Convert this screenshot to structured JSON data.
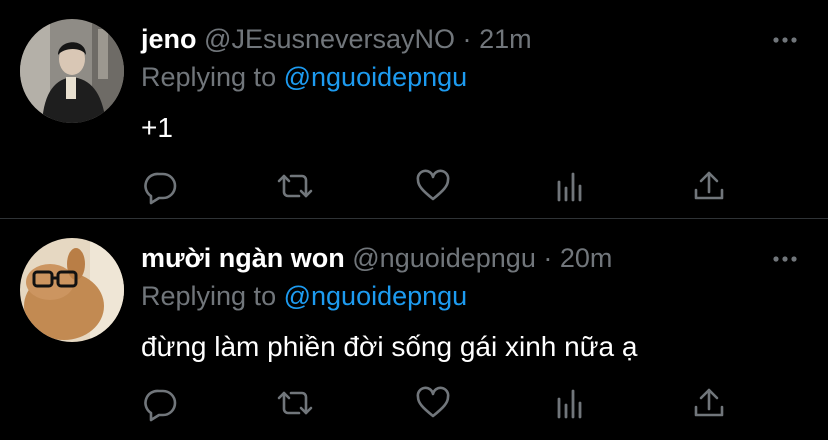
{
  "tweets": [
    {
      "name": "jeno",
      "handle": "@JEsusneversayNO",
      "separator": "·",
      "time": "21m",
      "replying_prefix": "Replying to",
      "replying_to": "@nguoidepngu",
      "text": "+1",
      "avatar_icon": "profile-photo-person-icon",
      "actions": [
        "reply-icon",
        "retweet-icon",
        "like-icon",
        "analytics-icon",
        "share-icon"
      ],
      "more_icon": "more-options-icon"
    },
    {
      "name": "mười ngàn won",
      "handle": "@nguoidepngu",
      "separator": "·",
      "time": "20m",
      "replying_prefix": "Replying to",
      "replying_to": "@nguoidepngu",
      "text": "đừng làm phiền đời sống gái xinh nữa ạ",
      "avatar_icon": "profile-photo-rabbit-glasses-icon",
      "actions": [
        "reply-icon",
        "retweet-icon",
        "like-icon",
        "analytics-icon",
        "share-icon"
      ],
      "more_icon": "more-options-icon"
    }
  ],
  "colors": {
    "background": "#000000",
    "primary_text": "#ffffff",
    "secondary_text": "#71767b",
    "accent": "#1d9bf0",
    "divider": "#2f3336"
  }
}
